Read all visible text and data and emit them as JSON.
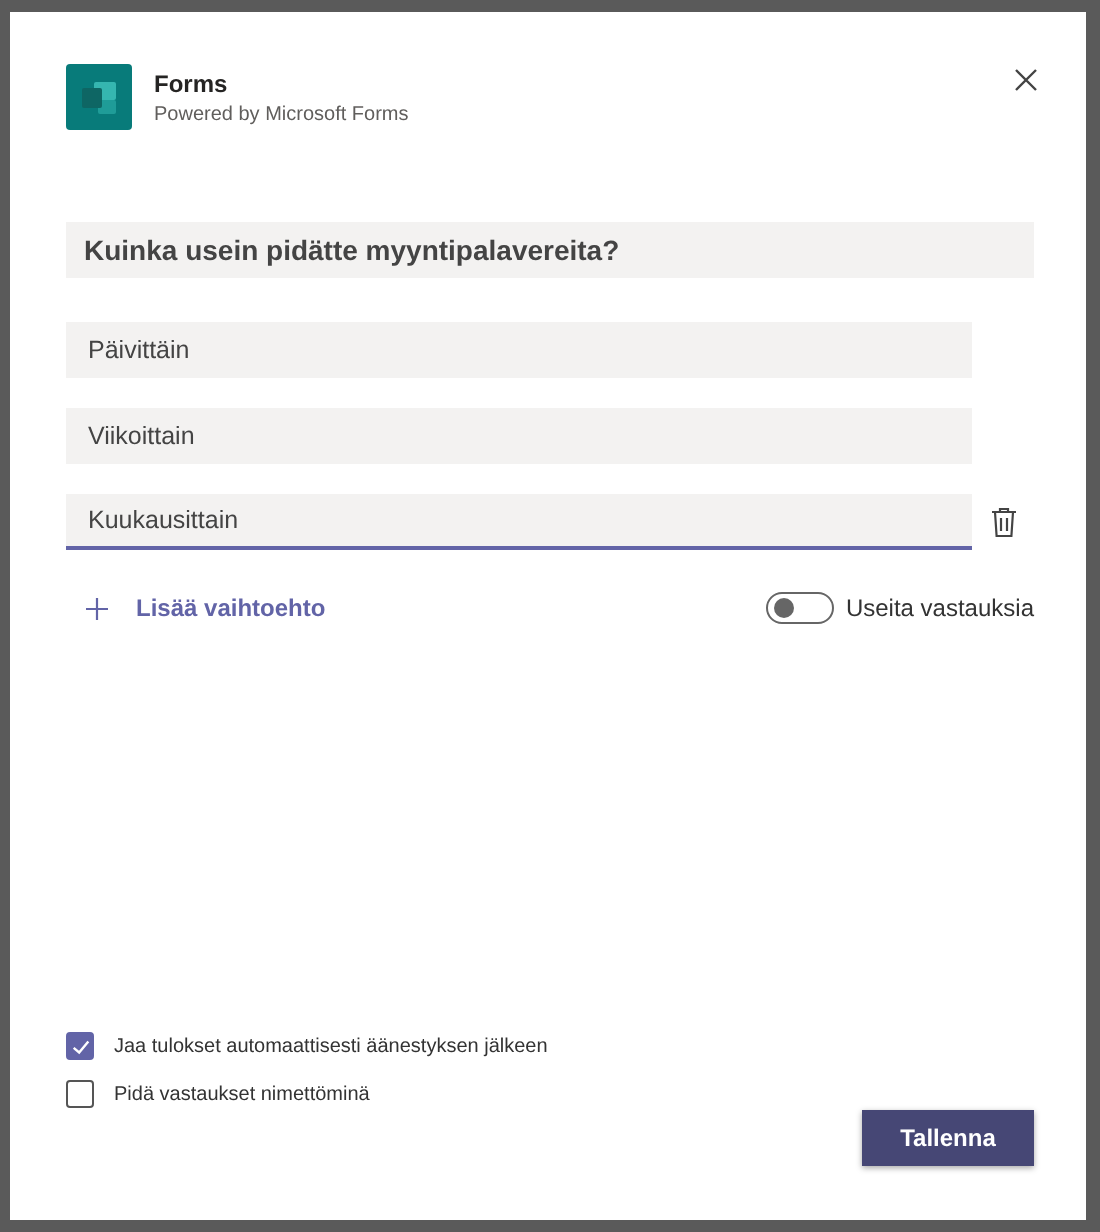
{
  "dialog": {
    "app_name": "Forms",
    "subtitle": "Powered by Microsoft Forms"
  },
  "question": "Kuinka usein pidätte myyntipalavereita?",
  "options": [
    {
      "text": "Päivittäin",
      "focused": false
    },
    {
      "text": "Viikoittain",
      "focused": false
    },
    {
      "text": "Kuukausittain",
      "focused": true
    }
  ],
  "add_option": "Lisää vaihtoehto",
  "multiple_answers": {
    "label": "Useita vastauksia",
    "on": false
  },
  "settings": [
    {
      "label": "Jaa tulokset automaattisesti äänestyksen jälkeen",
      "checked": true
    },
    {
      "label": "Pidä vastaukset nimettöminä",
      "checked": false
    }
  ],
  "save_button": "Tallenna"
}
